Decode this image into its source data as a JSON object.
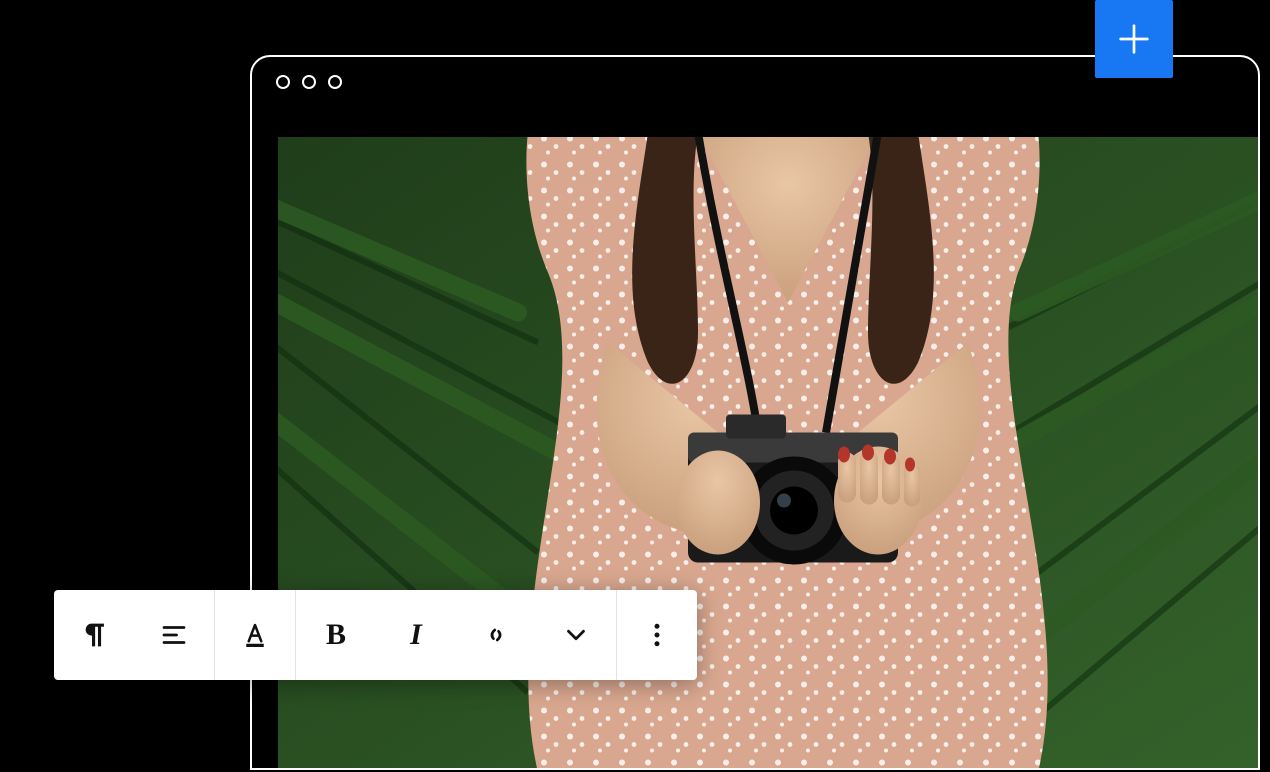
{
  "colors": {
    "accent": "#1877F2",
    "toolbar_bg": "#ffffff",
    "icon": "#111111"
  },
  "add_button": {
    "icon": "plus"
  },
  "window": {
    "traffic_lights": 3,
    "image_alt": "Person in floral dress holding a vintage camera in front of green palm leaves"
  },
  "toolbar": {
    "groups": [
      {
        "buttons": [
          {
            "name": "paragraph",
            "icon": "pilcrow"
          },
          {
            "name": "align",
            "icon": "align-left"
          }
        ]
      },
      {
        "buttons": [
          {
            "name": "text-color",
            "icon": "text-color"
          }
        ]
      },
      {
        "buttons": [
          {
            "name": "bold",
            "label": "B"
          },
          {
            "name": "italic",
            "label": "I"
          },
          {
            "name": "link",
            "icon": "link"
          },
          {
            "name": "more-inline",
            "icon": "chevron-down"
          }
        ]
      },
      {
        "buttons": [
          {
            "name": "more-options",
            "icon": "more-vertical"
          }
        ]
      }
    ]
  }
}
